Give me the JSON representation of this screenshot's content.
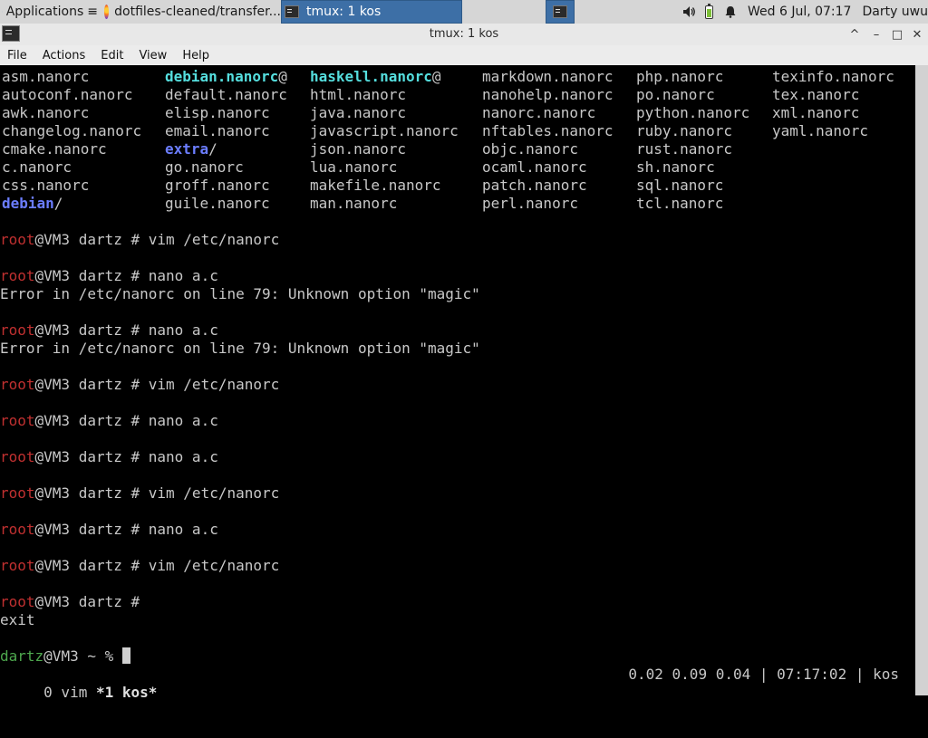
{
  "panel": {
    "applications": "Applications",
    "separator": "≡",
    "task_firefox": "dotfiles-cleaned/transfer...",
    "task_terminal": "tmux: 1 kos",
    "clock": "Wed  6 Jul, 07:17",
    "user": "Darty uwu"
  },
  "window": {
    "title": "tmux: 1 kos",
    "minimize": "^",
    "maximize": "–",
    "restore": "□",
    "close": "✕"
  },
  "menu": [
    "File",
    "Actions",
    "Edit",
    "View",
    "Help"
  ],
  "listing": {
    "col1": [
      "asm.nanorc",
      "autoconf.nanorc",
      "awk.nanorc",
      "changelog.nanorc",
      "cmake.nanorc",
      "c.nanorc",
      "css.nanorc"
    ],
    "col1_dir_name": "debian",
    "col1_dir_suffix": "/",
    "col2_top_name": "debian.nanorc",
    "col2_top_suffix": "@",
    "col2": [
      "default.nanorc",
      "elisp.nanorc",
      "email.nanorc"
    ],
    "col2_dir_name": "extra",
    "col2_dir_suffix": "/",
    "col2b": [
      "go.nanorc",
      "groff.nanorc",
      "guile.nanorc"
    ],
    "col3_top_name": "haskell.nanorc",
    "col3_top_suffix": "@",
    "col3": [
      "html.nanorc",
      "java.nanorc",
      "javascript.nanorc",
      "json.nanorc",
      "lua.nanorc",
      "makefile.nanorc",
      "man.nanorc"
    ],
    "col4": [
      "markdown.nanorc",
      "nanohelp.nanorc",
      "nanorc.nanorc",
      "nftables.nanorc",
      "objc.nanorc",
      "ocaml.nanorc",
      "patch.nanorc",
      "perl.nanorc"
    ],
    "col5": [
      "php.nanorc",
      "po.nanorc",
      "python.nanorc",
      "ruby.nanorc",
      "rust.nanorc",
      "sh.nanorc",
      "sql.nanorc",
      "tcl.nanorc"
    ],
    "col6": [
      "texinfo.nanorc",
      "tex.nanorc",
      "xml.nanorc",
      "yaml.nanorc"
    ]
  },
  "prompt": {
    "user": "root",
    "host": "@VM3 dartz # "
  },
  "history": [
    {
      "cmd": "vim /etc/nanorc",
      "out": ""
    },
    {
      "cmd": "nano a.c",
      "out": "Error in /etc/nanorc on line 79: Unknown option \"magic\""
    },
    {
      "cmd": "nano a.c",
      "out": "Error in /etc/nanorc on line 79: Unknown option \"magic\""
    },
    {
      "cmd": "vim /etc/nanorc",
      "out": ""
    },
    {
      "cmd": "nano a.c",
      "out": ""
    },
    {
      "cmd": "nano a.c",
      "out": ""
    },
    {
      "cmd": "vim /etc/nanorc",
      "out": ""
    },
    {
      "cmd": "nano a.c",
      "out": ""
    },
    {
      "cmd": "vim /etc/nanorc",
      "out": ""
    },
    {
      "cmd": "",
      "out": "exit"
    }
  ],
  "user_prompt": {
    "user": "dartz",
    "rest": "@VM3 ~ % "
  },
  "tmux": {
    "left_plain": " 0 vim ",
    "left_active": "*1 kos*",
    "right": "0.02 0.09 0.04 | 07:17:02 | kos"
  }
}
